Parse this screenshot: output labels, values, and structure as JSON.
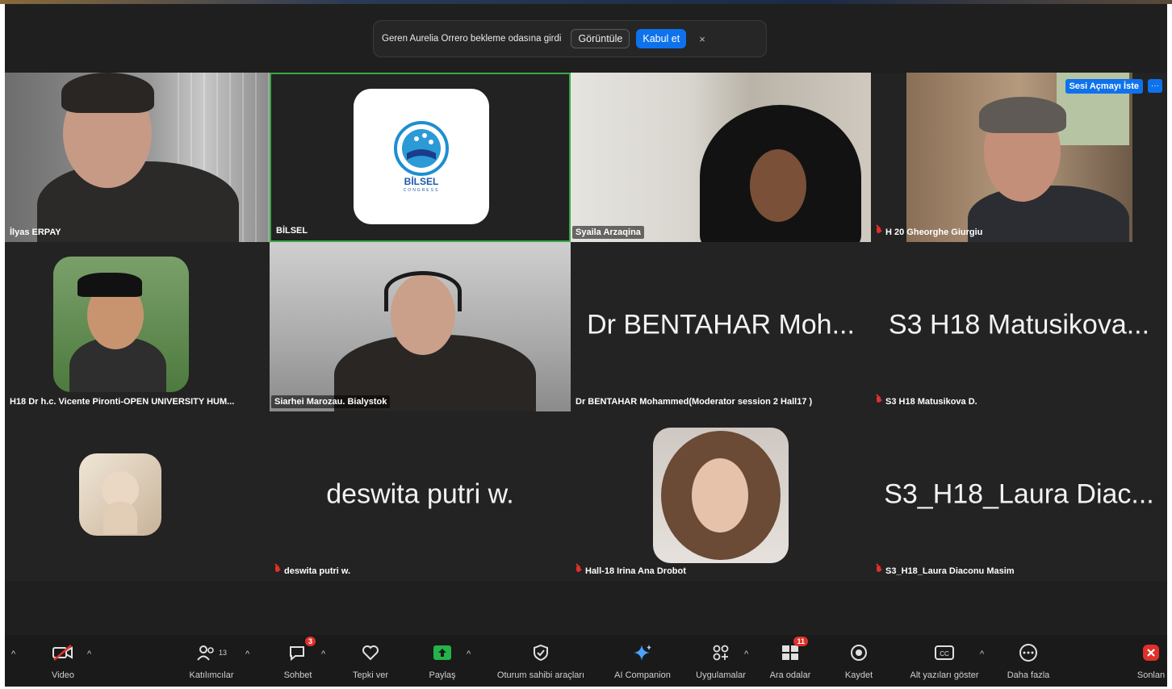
{
  "notification": {
    "message": "Geren Aurelia Orrero bekleme odasına girdi",
    "view_label": "Görüntüle",
    "accept_label": "Kabul et",
    "close_glyph": "×"
  },
  "tiles": {
    "t1": {
      "name": "İlyas ERPAY"
    },
    "t2": {
      "name": "BİLSEL",
      "logo_text": "BİLSEL",
      "logo_sub": "CONGRESS"
    },
    "t3": {
      "name": "Syaila Arzaqina"
    },
    "t4": {
      "name": "H 20 Gheorghe Giurgiu",
      "unmute_label": "Sesi Açmayı İste",
      "more_glyph": "···"
    },
    "t5": {
      "name": "H18 Dr h.c. Vicente Pironti-OPEN UNIVERSITY HUM..."
    },
    "t6": {
      "name": "Siarhei Marozau. Bialystok"
    },
    "t7": {
      "big": "Dr BENTAHAR Moh...",
      "name": "Dr BENTAHAR Mohammed(Moderator session 2 Hall17 )"
    },
    "t8": {
      "big": "S3 H18 Matusikova...",
      "name": "S3 H18 Matusikova D."
    },
    "t9": {
      "name": ""
    },
    "t10": {
      "big": "deswita putri w.",
      "name": "deswita putri w."
    },
    "t11": {
      "name": "Hall-18 Irina Ana Drobot"
    },
    "t12": {
      "big": "S3_H18_Laura Diac...",
      "name": "S3_H18_Laura Diaconu Masim"
    }
  },
  "toolbar": {
    "video": "Video",
    "participants": "Katılımcılar",
    "participants_count": "13",
    "chat": "Sohbet",
    "chat_badge": "3",
    "react": "Tepki ver",
    "share": "Paylaş",
    "host_tools": "Oturum sahibi araçları",
    "ai_companion": "AI Companion",
    "apps": "Uygulamalar",
    "breakout": "Ara odalar",
    "breakout_badge": "11",
    "record": "Kaydet",
    "captions": "Alt yazıları göster",
    "more": "Daha fazla",
    "end": "Sonlan"
  },
  "colors": {
    "accent": "#0e72ed",
    "active_speaker_border": "#3aa845",
    "muted_red": "#e0302a",
    "background": "#1f1f1f"
  }
}
